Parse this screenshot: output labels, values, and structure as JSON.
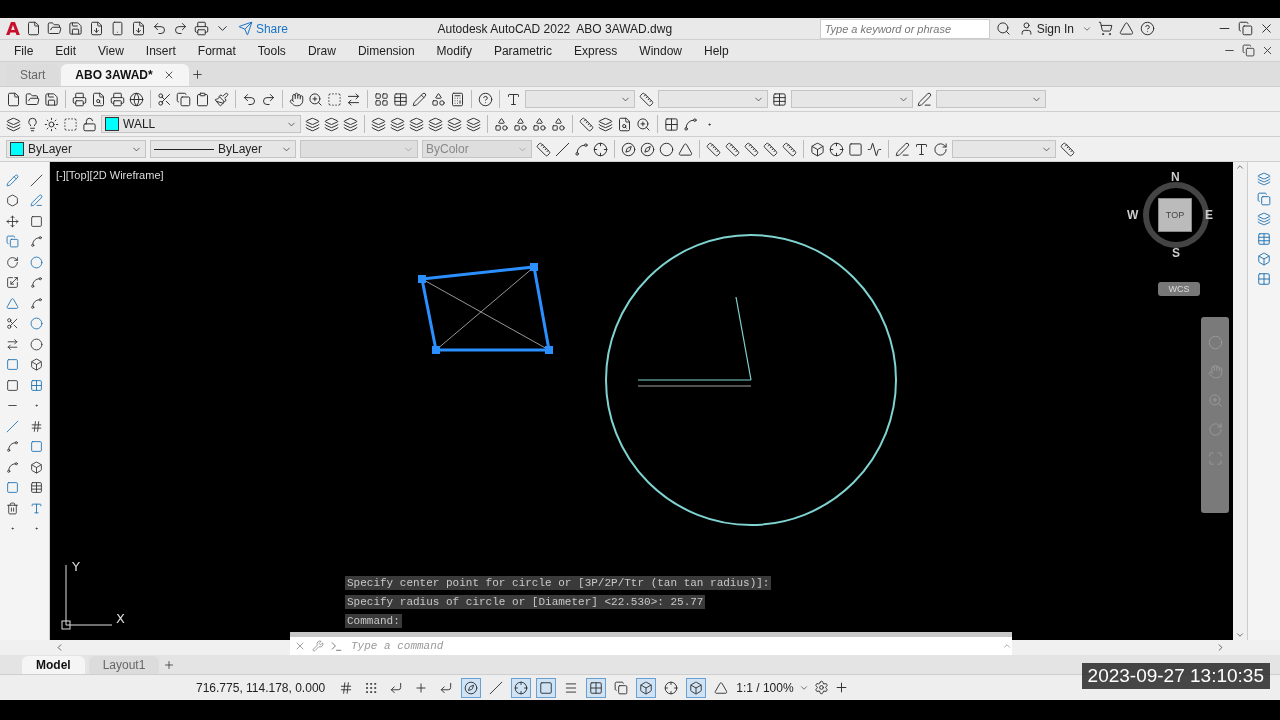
{
  "title_bar": {
    "app_logo": "A",
    "share": "Share",
    "app_name": "Autodesk AutoCAD 2022",
    "file_name": "ABO 3AWAD.dwg",
    "search": {
      "placeholder": "Type a keyword or phrase"
    },
    "sign_in": "Sign In"
  },
  "menu": [
    "File",
    "Edit",
    "View",
    "Insert",
    "Format",
    "Tools",
    "Draw",
    "Dimension",
    "Modify",
    "Parametric",
    "Express",
    "Window",
    "Help"
  ],
  "file_tabs": [
    {
      "label": "Start",
      "selected": false
    },
    {
      "label": "ABO 3AWAD*",
      "selected": true
    }
  ],
  "layer_toolbar": {
    "layer": "WALL"
  },
  "properties_toolbar": {
    "color_setting": "ByLayer",
    "linetype": "ByLayer",
    "plot_style": "ByColor"
  },
  "viewport": {
    "label": "[-][Top][2D Wireframe]",
    "viewcube": {
      "north": "N",
      "west": "W",
      "east": "E",
      "south": "S",
      "face": "TOP",
      "ucs": "WCS"
    },
    "ucs_icon": {
      "x": "X",
      "y": "Y"
    }
  },
  "command_history": [
    "Specify center point for circle or [3P/2P/Ttr (tan tan radius)]:",
    "Specify radius of circle or [Diameter] <22.530>: 25.77",
    "Command:"
  ],
  "command_line": {
    "placeholder": "Type a command"
  },
  "layout_tabs": [
    {
      "label": "Model",
      "selected": true
    },
    {
      "label": "Layout1",
      "selected": false
    }
  ],
  "status_bar": {
    "coordinates": "716.775, 114.178, 0.000",
    "annotation_scale": "1:1 / 100%",
    "toggles": [
      {
        "on": false
      },
      {
        "on": false
      },
      {
        "on": false
      },
      {
        "on": false
      },
      {
        "on": false
      },
      {
        "on": true
      },
      {
        "on": false
      },
      {
        "on": true
      },
      {
        "on": true
      },
      {
        "on": false
      },
      {
        "on": true
      },
      {
        "on": false
      },
      {
        "on": true
      },
      {
        "on": false
      },
      {
        "on": true
      },
      {
        "on": false
      }
    ]
  },
  "timestamp": "2023-09-27  13:10:35"
}
